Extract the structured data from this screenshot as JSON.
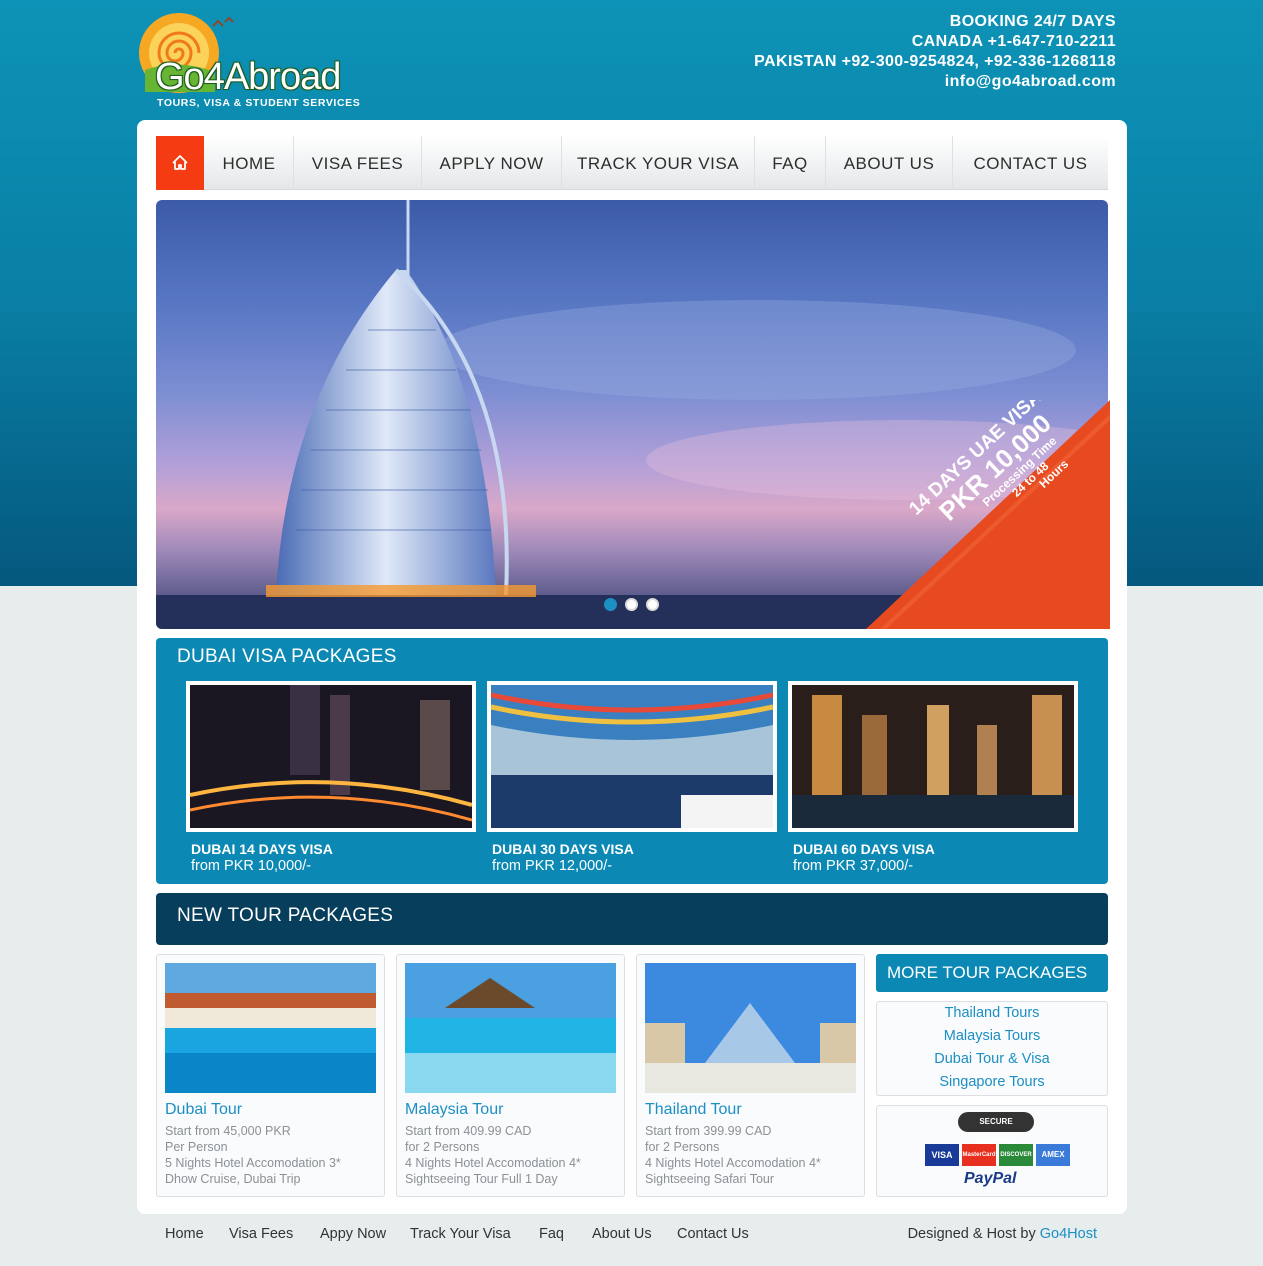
{
  "brand": {
    "name": "Go4Abroad",
    "tagline": "TOURS, VISA & STUDENT SERVICES"
  },
  "contact": {
    "line1": "BOOKING 24/7 DAYS",
    "line2": "CANADA +1-647-710-2211",
    "line3": "PAKISTAN +92-300-9254824, +92-336-1268118",
    "line4": "info@go4abroad.com"
  },
  "nav": {
    "home_icon": "home-icon",
    "items": [
      "HOME",
      "VISA FEES",
      "APPLY NOW",
      "TRACK YOUR VISA",
      "FAQ",
      "ABOUT US",
      "CONTACT US"
    ]
  },
  "hero": {
    "badge_line1": "14 DAYS UAE VISA",
    "badge_line2": "PKR 10,000",
    "badge_line3": "Processing Time",
    "badge_line4": "24 to 48",
    "badge_line5": "Hours",
    "slides": 3,
    "active_slide": 1
  },
  "dubai_packages": {
    "title": "DUBAI VISA PACKAGES",
    "items": [
      {
        "name": "DUBAI 14 DAYS VISA",
        "price": "from PKR 10,000/-"
      },
      {
        "name": "DUBAI 30 DAYS VISA",
        "price": "from PKR 12,000/-"
      },
      {
        "name": "DUBAI 60 DAYS VISA",
        "price": "from PKR 37,000/-"
      }
    ]
  },
  "new_tours": {
    "title": "NEW TOUR PACKAGES",
    "items": [
      {
        "name": "Dubai Tour",
        "l1": "Start from 45,000 PKR",
        "l2": "Per Person",
        "l3": "5 Nights Hotel Accomodation 3*",
        "l4": "Dhow Cruise, Dubai Trip"
      },
      {
        "name": "Malaysia Tour",
        "l1": "Start from 409.99 CAD",
        "l2": "for 2 Persons",
        "l3": "4 Nights Hotel Accomodation 4*",
        "l4": "Sightseeing Tour Full 1 Day"
      },
      {
        "name": "Thailand Tour",
        "l1": "Start from 399.99 CAD",
        "l2": "for 2 Persons",
        "l3": "4 Nights Hotel Accomodation 4*",
        "l4": "Sightseeing Safari Tour"
      }
    ]
  },
  "more_tours": {
    "title": "MORE TOUR PACKAGES",
    "links": [
      "Thailand Tours",
      "Malaysia Tours",
      "Dubai Tour & Visa",
      "Singapore Tours"
    ]
  },
  "payment": {
    "secure": "SECURE SHOPPING",
    "cards": [
      "VISA",
      "MasterCard",
      "DISCOVER",
      "AMEX"
    ],
    "paypal": "PayPal"
  },
  "footer": {
    "links": [
      "Home",
      "Visa Fees",
      "Appy Now",
      "Track Your Visa",
      "Faq",
      "About Us",
      "Contact Us"
    ],
    "credit_prefix": "Designed & Host by ",
    "credit_link": "Go4Host"
  },
  "colors": {
    "accent": "#0b89b4",
    "dark": "#073e5b",
    "home_red": "#f43b12",
    "link": "#1c8fc4"
  }
}
